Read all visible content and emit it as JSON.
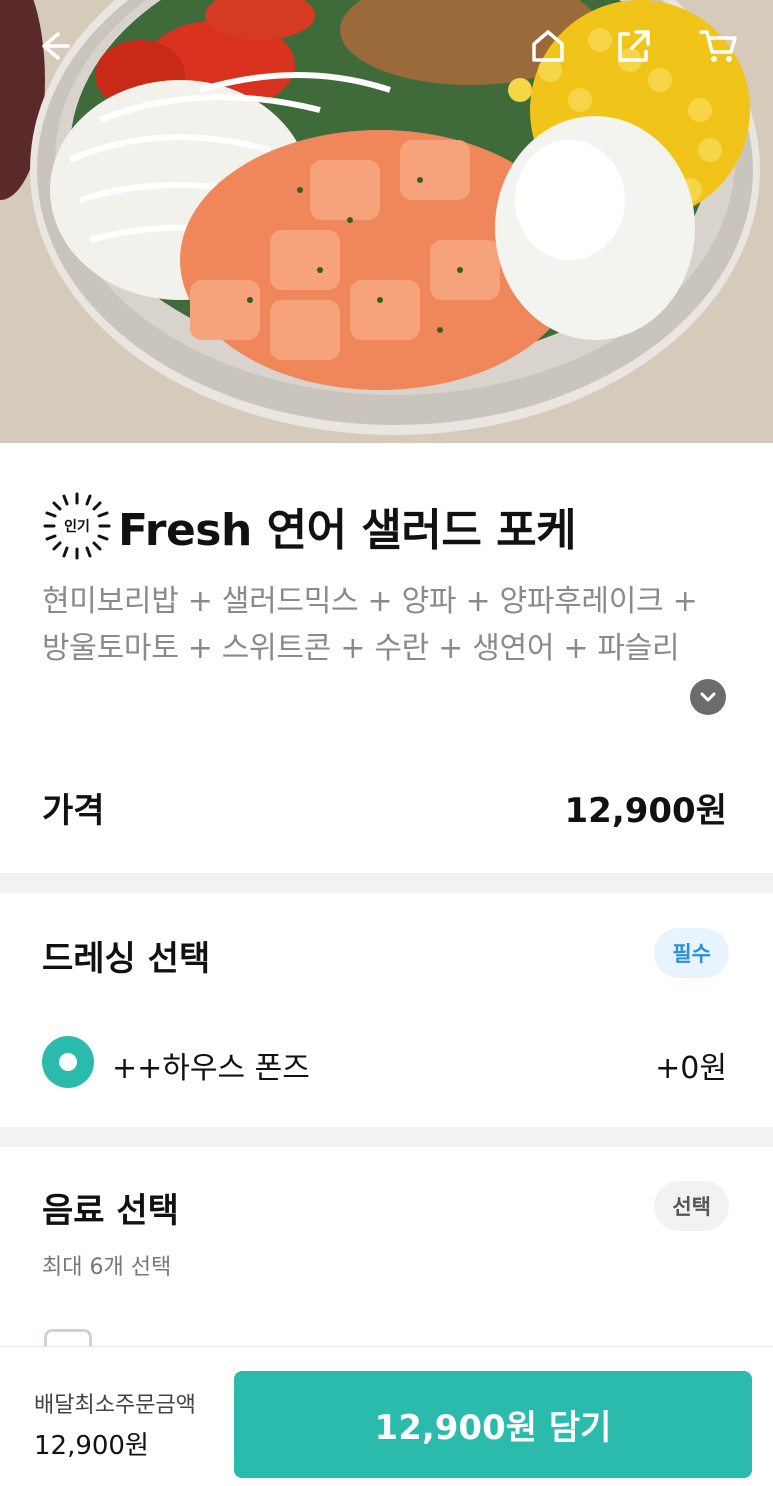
{
  "hero": {
    "icons": [
      "back-arrow-icon",
      "home-icon",
      "share-icon",
      "cart-icon"
    ],
    "colors": {
      "icon": "#ffffff"
    }
  },
  "menu": {
    "badge": "인기",
    "title": "Fresh 연어 샐러드 포케",
    "description": "현미보리밥 + 샐러드믹스 + 양파 + 양파후레이크 + 방울토마토 + 스위트콘 + 수란 + 생연어 + 파슬리",
    "price_label": "가격",
    "price_value": "12,900원"
  },
  "dressing": {
    "title": "드레싱 선택",
    "tag": "필수",
    "option_label": "++하우스 폰즈",
    "option_price": "+0원"
  },
  "drink": {
    "title": "음료 선택",
    "tag": "선택",
    "note": "최대 6개 선택"
  },
  "bottom": {
    "min_order_label": "배달최소주문금액",
    "min_order_value": "12,900원",
    "add_button": "12,900원 담기"
  },
  "colors": {
    "accent": "#2bbbad",
    "required_tag_bg": "#e8f4fd",
    "required_tag_text": "#2d8fd9"
  }
}
